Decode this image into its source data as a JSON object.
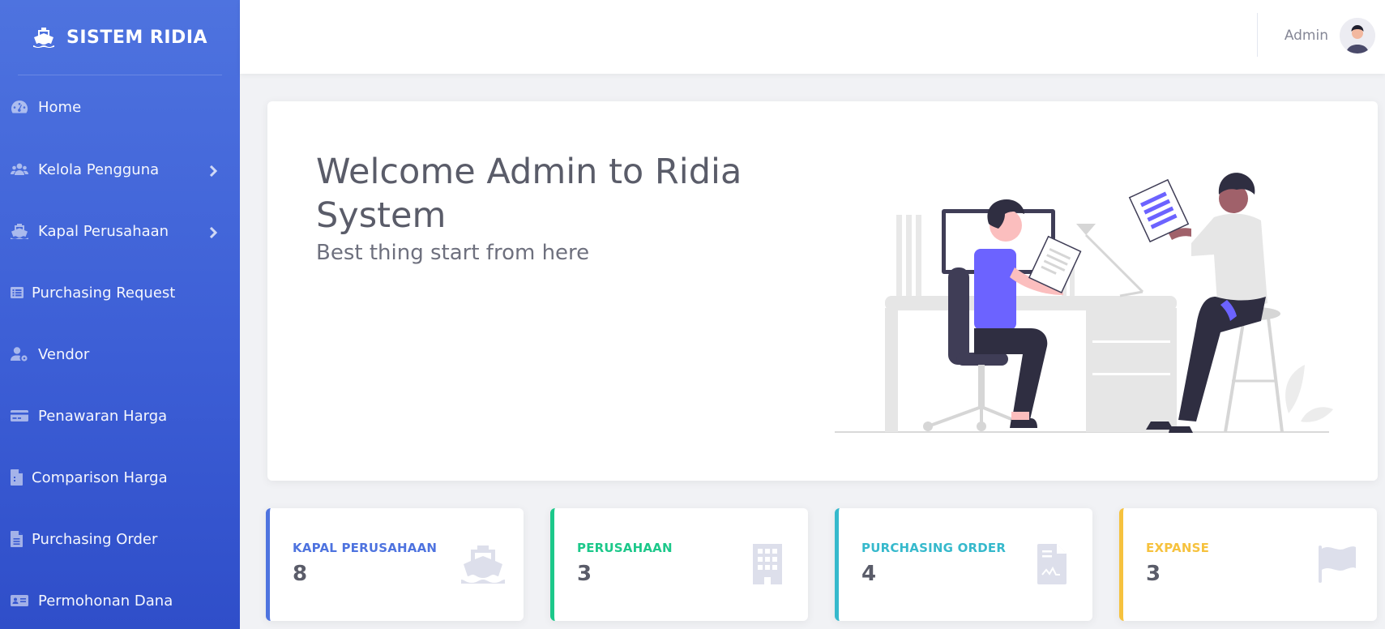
{
  "brand": {
    "title": "SISTEM RIDIA",
    "icon": "ship-icon"
  },
  "sidebar": {
    "items": [
      {
        "label": "Home",
        "icon": "dashboard-icon"
      },
      {
        "label": "Kelola Pengguna",
        "icon": "users-icon",
        "has_submenu": true
      },
      {
        "label": "Kapal Perusahaan",
        "icon": "ship-icon",
        "has_submenu": true
      },
      {
        "label": "Purchasing Request",
        "icon": "list-icon"
      },
      {
        "label": "Vendor",
        "icon": "user-cog-icon"
      },
      {
        "label": "Penawaran Harga",
        "icon": "credit-card-icon"
      },
      {
        "label": "Comparison Harga",
        "icon": "file-icon"
      },
      {
        "label": "Purchasing Order",
        "icon": "file-alt-icon"
      },
      {
        "label": "Permohonan Dana",
        "icon": "id-card-icon"
      }
    ]
  },
  "topbar": {
    "user_name": "Admin",
    "avatar_icon": "avatar"
  },
  "welcome": {
    "title": "Welcome Admin to Ridia System",
    "subtitle": "Best thing start from here"
  },
  "stats": [
    {
      "label": "KAPAL PERUSAHAAN",
      "value": "8",
      "color": "#4e73df",
      "icon": "ship-icon"
    },
    {
      "label": "PERUSAHAAN",
      "value": "3",
      "color": "#1cc88a",
      "icon": "building-icon"
    },
    {
      "label": "PURCHASING ORDER",
      "value": "4",
      "color": "#36b9cc",
      "icon": "file-contract-icon"
    },
    {
      "label": "EXPANSE",
      "value": "3",
      "color": "#f6c23e",
      "icon": "flag-icon"
    }
  ]
}
